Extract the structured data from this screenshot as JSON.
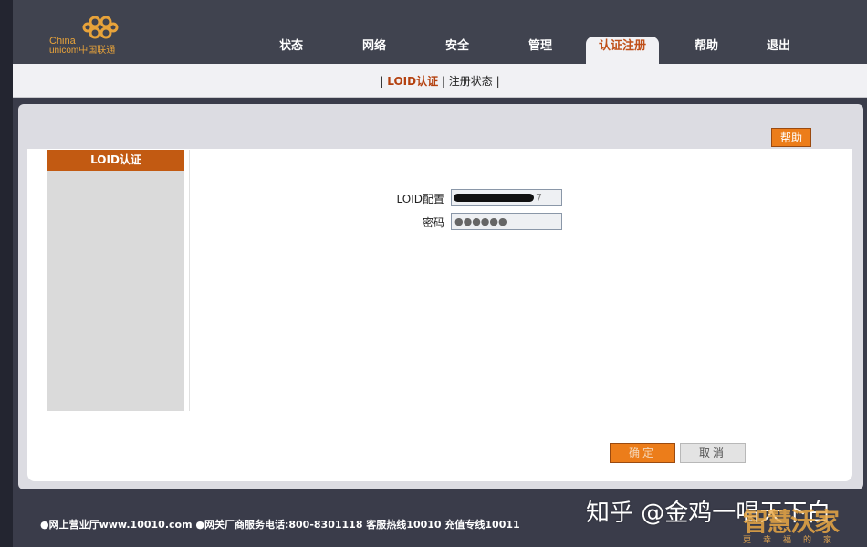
{
  "brand": {
    "logo_line1": "China",
    "logo_line2": "unicom中国联通",
    "colors": {
      "header": "#40434f",
      "accent": "#ec7d1a",
      "active_text": "#c0501a",
      "logo": "#e8a33a"
    }
  },
  "nav": {
    "items": [
      {
        "label": "状态"
      },
      {
        "label": "网络"
      },
      {
        "label": "安全"
      },
      {
        "label": "管理"
      },
      {
        "label": "认证注册",
        "active": true
      },
      {
        "label": "帮助"
      },
      {
        "label": "退出"
      }
    ]
  },
  "subnav": {
    "sep_left": "| ",
    "item1": "LOID认证",
    "sep_mid": " | ",
    "item2": "注册状态",
    "sep_right": " |"
  },
  "help_button": "帮助",
  "sidebar": {
    "header": "LOID认证"
  },
  "form": {
    "loid_label": "LOID配置",
    "loid_value_tail": "7",
    "password_label": "密码",
    "password_value": "●●●●●●"
  },
  "buttons": {
    "ok": "确定",
    "cancel": "取消"
  },
  "footer": {
    "text": "●网上营业厅www.10010.com ●网关厂商服务电话:800-8301118 客服热线10010 充值专线10011"
  },
  "watermark": {
    "text": "知乎 @金鸡一唱天下白",
    "logo_big": "智慧沃家",
    "logo_small": "更幸福的家"
  }
}
